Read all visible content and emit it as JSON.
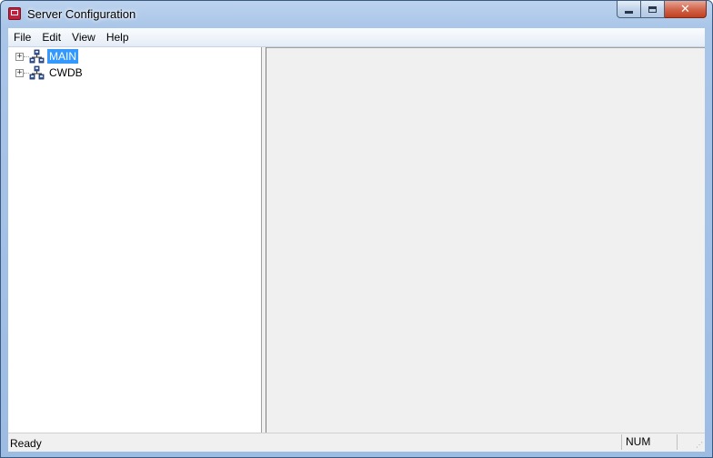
{
  "window": {
    "title": "Server Configuration"
  },
  "caption_buttons": {
    "minimize_icon": "minimize-icon",
    "maximize_icon": "maximize-icon",
    "close_glyph": "✕"
  },
  "menu": {
    "items": [
      {
        "label": "File"
      },
      {
        "label": "Edit"
      },
      {
        "label": "View"
      },
      {
        "label": "Help"
      }
    ]
  },
  "tree": {
    "nodes": [
      {
        "label": "MAIN",
        "selected": true,
        "expander": "+",
        "icon": "server-group-icon"
      },
      {
        "label": "CWDB",
        "selected": false,
        "expander": "+",
        "icon": "server-group-icon"
      }
    ]
  },
  "status": {
    "text": "Ready",
    "num": "NUM"
  },
  "colors": {
    "selection": "#3399ff",
    "title_gradient_top": "#bcd3ee",
    "close_button": "#c2401f"
  }
}
